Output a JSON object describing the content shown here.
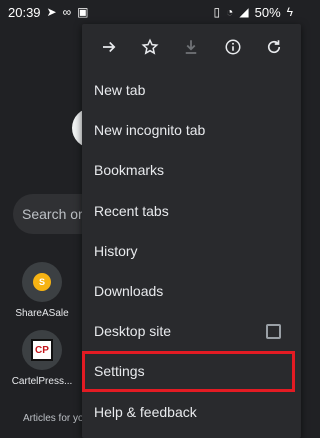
{
  "status_bar": {
    "time": "20:39",
    "battery": "50%"
  },
  "background": {
    "search_placeholder": "Search or",
    "tiles": [
      {
        "label": "ShareASale",
        "icon_text": "S"
      },
      {
        "label": "CartelPress...",
        "icon_text": "CP"
      }
    ],
    "articles_label": "Articles for yo"
  },
  "menu": {
    "toolbar": {
      "icons": [
        "forward-icon",
        "bookmark-star-icon",
        "download-icon",
        "info-icon",
        "refresh-icon"
      ]
    },
    "items": [
      {
        "label": "New tab"
      },
      {
        "label": "New incognito tab"
      },
      {
        "label": "Bookmarks"
      },
      {
        "label": "Recent tabs"
      },
      {
        "label": "History"
      },
      {
        "label": "Downloads"
      },
      {
        "label": "Desktop site",
        "checkbox": false
      },
      {
        "label": "Settings",
        "highlighted": true
      },
      {
        "label": "Help & feedback"
      }
    ]
  },
  "colors": {
    "background": "#202124",
    "menu_background": "#292a2d",
    "text": "#e8eaed",
    "highlight_outline": "#e31b23"
  }
}
